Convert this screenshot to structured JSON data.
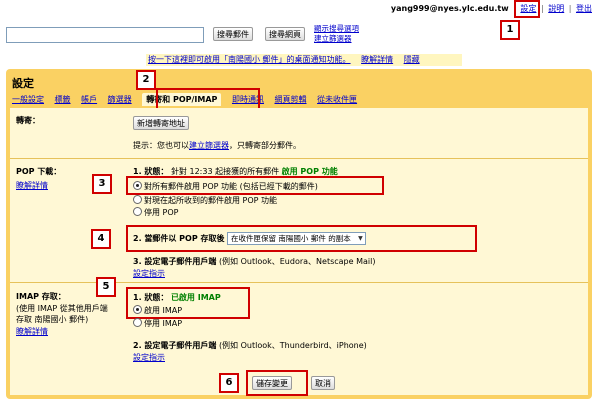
{
  "topbar": {
    "email": "yang999@nyes.ylc.edu.tw",
    "settings": "設定",
    "help": "說明",
    "signout": "登出"
  },
  "search": {
    "mail_button": "搜尋郵件",
    "web_button": "搜尋網頁",
    "options_link": "顯示搜尋選項",
    "filter_link": "建立篩選器"
  },
  "notice": {
    "text": "按一下這裡即可啟用「南陽國小 郵件」的桌面通知功能。",
    "more": "瞭解詳情",
    "hide": "隱藏"
  },
  "settings": {
    "title": "設定",
    "tabs": [
      "一般設定",
      "標籤",
      "帳戶",
      "篩選器",
      "轉寄和 POP/IMAP",
      "即時通訊",
      "網頁剪輯",
      "從未收件匣"
    ],
    "forwarding": {
      "label": "轉寄：",
      "add_button": "新增轉寄地址",
      "tip_prefix": "提示：您也可以",
      "tip_link": "建立篩選器",
      "tip_suffix": "，只轉寄部分郵件。"
    },
    "pop": {
      "label": "POP 下載：",
      "learn_more": "瞭解詳情",
      "status_prefix": "1. 狀態：",
      "status_text": "針對 12:33 起接獲的所有郵件",
      "status_enabled": "啟用 POP 功能",
      "options": [
        "對所有郵件啟用 POP 功能 (包括已經下載的郵件)",
        "對現在起所收到的郵件啟用 POP 功能",
        "停用 POP"
      ],
      "when_label": "2. 當郵件以 POP 存取後",
      "when_value": "在收件匣保留 南陽國小 郵件 的副本",
      "client_label": "3. 設定電子郵件用戶端",
      "client_text": "(例如 Outlook、Eudora、Netscape Mail)",
      "config_link": "設定指示"
    },
    "imap": {
      "label": "IMAP 存取：",
      "desc1": "(使用 IMAP 從其他用戶端",
      "desc2": "存取 南陽國小 郵件)",
      "learn_more": "瞭解詳情",
      "status_prefix": "1. 狀態：",
      "status_enabled": "已啟用 IMAP",
      "options": [
        "啟用 IMAP",
        "停用 IMAP"
      ],
      "client_label": "2. 設定電子郵件用戶端",
      "client_text": "(例如 Outlook、Thunderbird、iPhone)",
      "config_link": "設定指示"
    },
    "save_button": "儲存變更",
    "cancel_button": "取消"
  },
  "callouts": [
    "1",
    "2",
    "3",
    "4",
    "5",
    "6"
  ]
}
